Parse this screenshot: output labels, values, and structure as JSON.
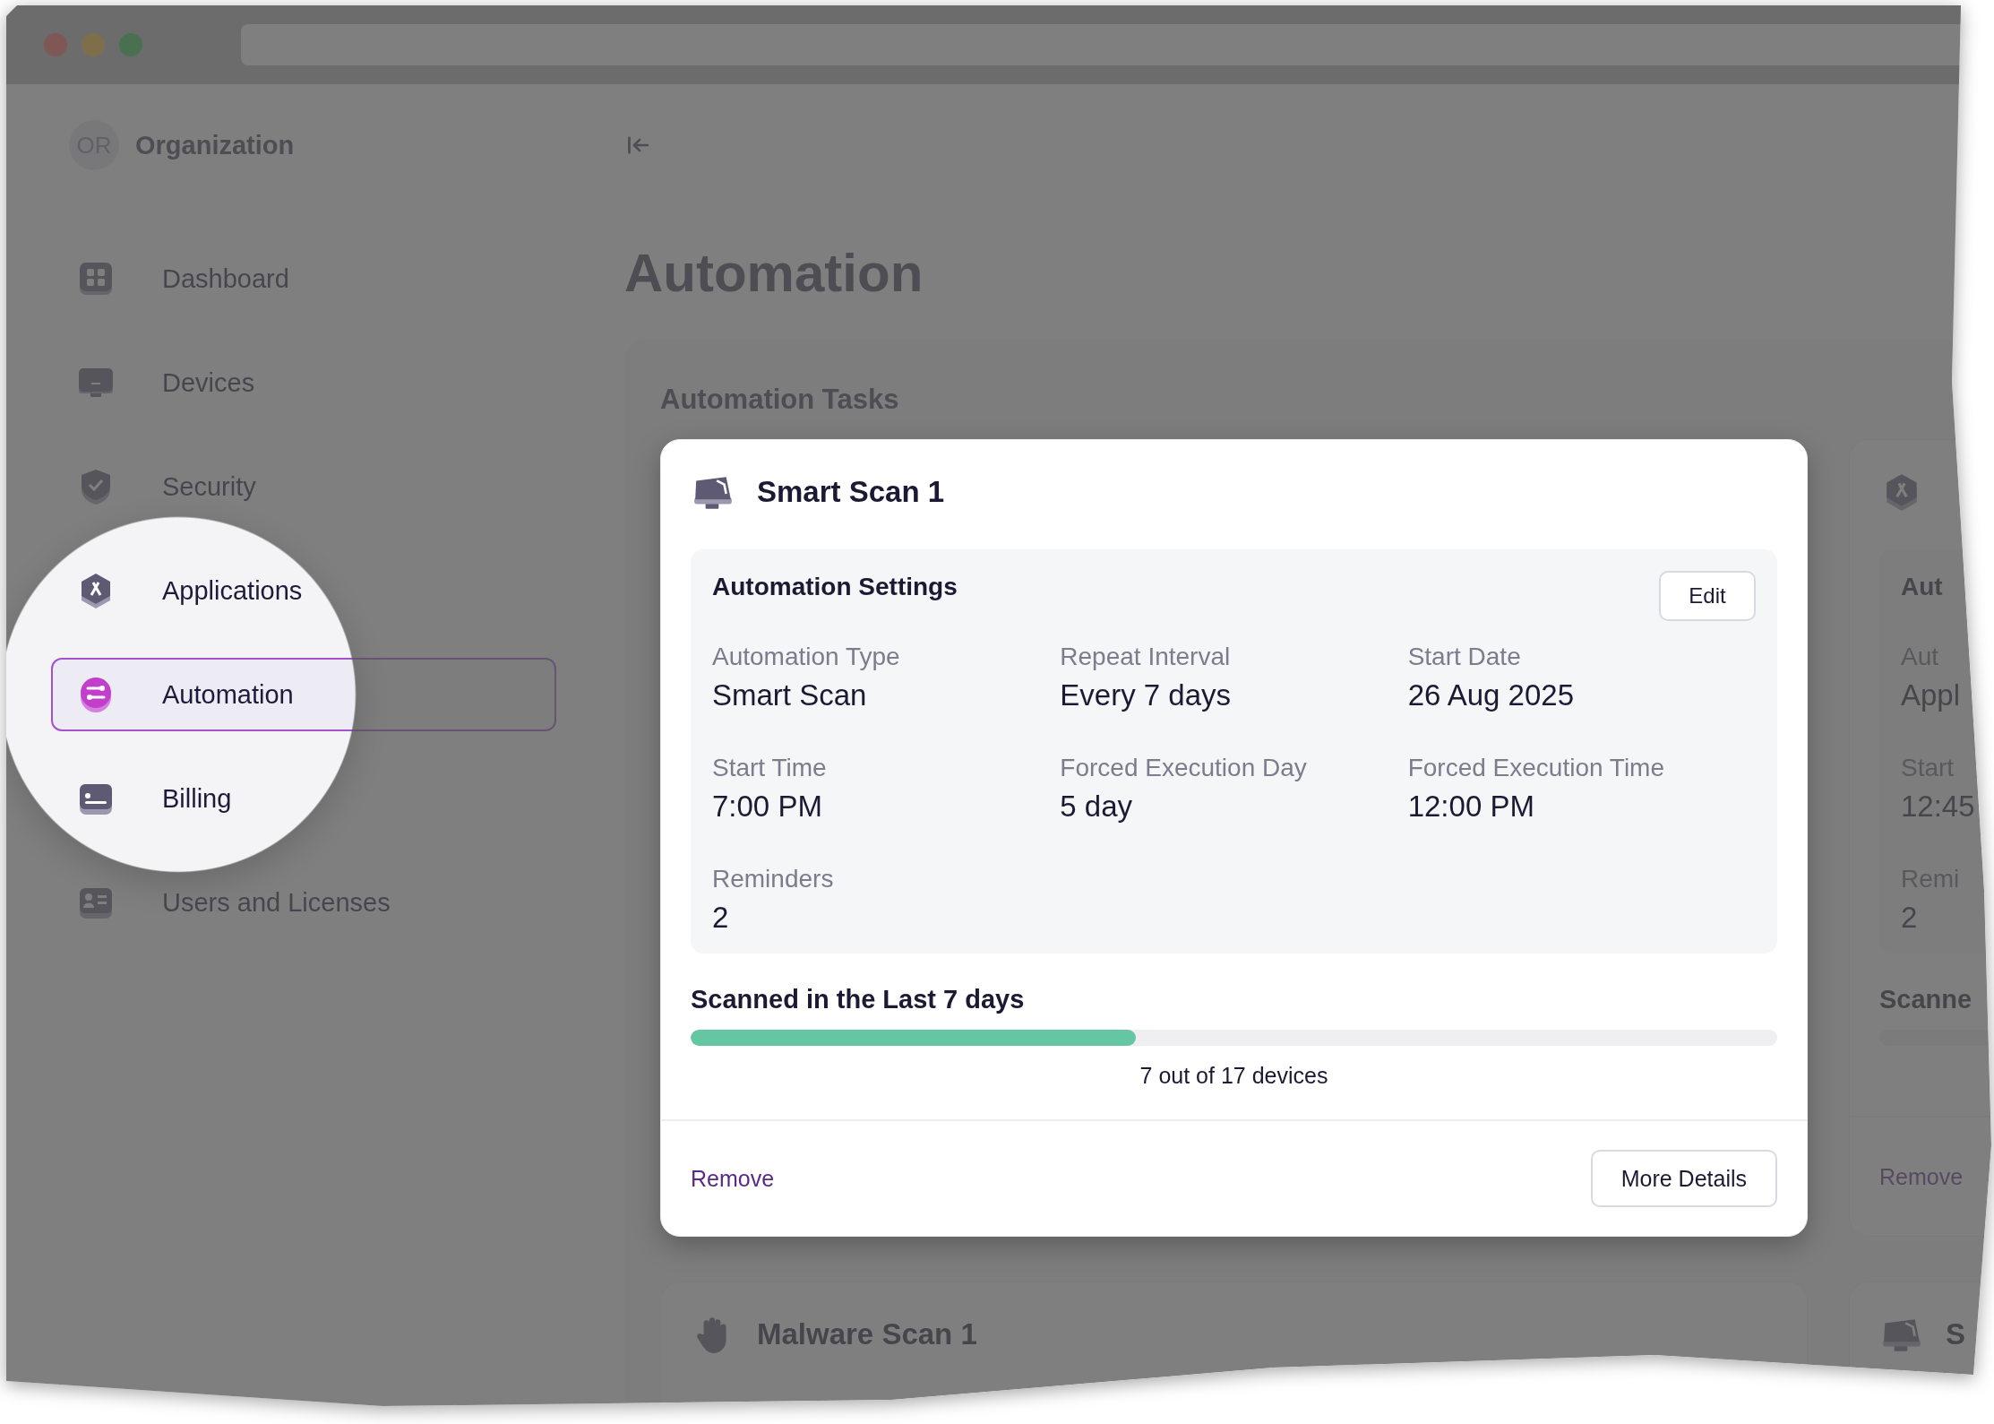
{
  "organization": {
    "initials": "OR",
    "name": "Organization"
  },
  "sidebar": {
    "items": [
      {
        "label": "Dashboard",
        "selected": false
      },
      {
        "label": "Devices",
        "selected": false
      },
      {
        "label": "Security",
        "selected": false
      },
      {
        "label": "Applications",
        "selected": false
      },
      {
        "label": "Automation",
        "selected": true
      },
      {
        "label": "Billing",
        "selected": false
      },
      {
        "label": "Users and Licenses",
        "selected": false
      }
    ]
  },
  "main": {
    "title": "Automation",
    "section_title": "Automation Tasks",
    "task_cards": [
      {
        "title": "Smart Scan 1",
        "highlighted": true,
        "settings": {
          "title": "Automation Settings",
          "edit": "Edit",
          "rows": [
            [
              {
                "label": "Automation Type",
                "value": "Smart Scan"
              },
              {
                "label": "Repeat Interval",
                "value": "Every 7 days"
              },
              {
                "label": "Start Date",
                "value": "26 Aug 2025"
              }
            ],
            [
              {
                "label": "Start Time",
                "value": "7:00 PM"
              },
              {
                "label": "Forced Execution Day",
                "value": "5 day"
              },
              {
                "label": "Forced Execution Time",
                "value": "12:00 PM"
              }
            ],
            [
              {
                "label": "Reminders",
                "value": "2"
              }
            ]
          ]
        },
        "progress": {
          "label": "Scanned in the Last 7 days",
          "level": 0.41,
          "reading": "7 out of 17 devices"
        },
        "remove": "Remove",
        "details": "More Details"
      },
      {
        "highlighted": false,
        "settings": {
          "title": "Aut",
          "rows": [
            [
              {
                "label": "Aut",
                "value": "Appl"
              }
            ],
            [
              {
                "label": "Start",
                "value": "12:45"
              }
            ],
            [
              {
                "label": "Remi",
                "value": "2"
              }
            ]
          ]
        },
        "progress": {
          "label": "Scanne"
        },
        "remove": "Remove"
      },
      {
        "title": "Malware Scan 1",
        "highlighted": false
      },
      {
        "title": "S",
        "highlighted": false
      }
    ]
  }
}
